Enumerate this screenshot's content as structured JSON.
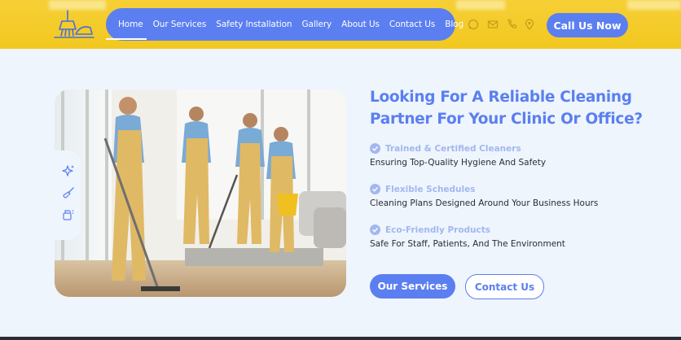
{
  "colors": {
    "accent": "#5b7ff0",
    "header_bg": "#f2c81f",
    "page_bg": "#eef5fd",
    "muted_accent": "#a3b7ef"
  },
  "nav": {
    "items": [
      {
        "label": "Home",
        "active": true
      },
      {
        "label": "Our Services",
        "active": false
      },
      {
        "label": "Safety Installation",
        "active": false
      },
      {
        "label": "Gallery",
        "active": false
      },
      {
        "label": "About Us",
        "active": false
      },
      {
        "label": "Contact Us",
        "active": false
      },
      {
        "label": "Blog",
        "active": false
      }
    ]
  },
  "social_icons": [
    "whatsapp-icon",
    "email-icon",
    "phone-icon",
    "location-icon"
  ],
  "header": {
    "cta_label": "Call Us Now"
  },
  "hero": {
    "headline_line1": "Looking For A Reliable Cleaning",
    "headline_line2": "Partner For Your Clinic Or Office?",
    "side_icons": [
      "sparkle-icon",
      "broom-icon",
      "cleaning-spray-icon"
    ],
    "features": [
      {
        "title": "Trained & Certified Cleaners",
        "desc": "Ensuring Top-Quality Hygiene And Safety"
      },
      {
        "title": "Flexible Schedules",
        "desc": "Cleaning Plans Designed Around Your Business Hours"
      },
      {
        "title": "Eco-Friendly Products",
        "desc": "Safe For Staff, Patients, And The Environment"
      }
    ],
    "primary_button": "Our Services",
    "secondary_button": "Contact Us"
  }
}
